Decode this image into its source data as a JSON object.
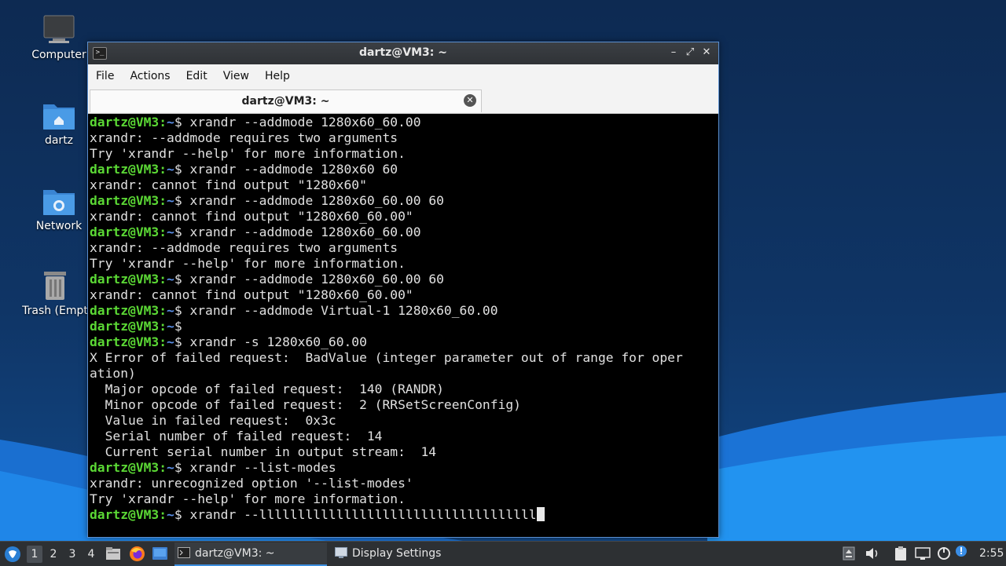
{
  "desktop": {
    "icons": [
      {
        "label": "Computer",
        "icon": "computer-icon"
      },
      {
        "label": "dartz",
        "icon": "home-folder-icon"
      },
      {
        "label": "Network",
        "icon": "network-folder-icon"
      },
      {
        "label": "Trash (Empt",
        "icon": "trash-icon"
      }
    ]
  },
  "window": {
    "title": "dartz@VM3: ~",
    "menu": [
      "File",
      "Actions",
      "Edit",
      "View",
      "Help"
    ],
    "tab_label": "dartz@VM3: ~",
    "buttons": {
      "minimize": "–",
      "maximize": "⤢",
      "close": "✕"
    }
  },
  "terminal": {
    "user_host": "dartz@VM3",
    "path": "~",
    "lines": [
      {
        "type": "prompt",
        "cmd": "xrandr --addmode 1280x60_60.00"
      },
      {
        "type": "out",
        "text": "xrandr: --addmode requires two arguments"
      },
      {
        "type": "out",
        "text": "Try 'xrandr --help' for more information."
      },
      {
        "type": "prompt",
        "cmd": "xrandr --addmode 1280x60 60"
      },
      {
        "type": "out",
        "text": "xrandr: cannot find output \"1280x60\""
      },
      {
        "type": "prompt",
        "cmd": "xrandr --addmode 1280x60_60.00 60"
      },
      {
        "type": "out",
        "text": "xrandr: cannot find output \"1280x60_60.00\""
      },
      {
        "type": "prompt",
        "cmd": "xrandr --addmode 1280x60_60.00"
      },
      {
        "type": "out",
        "text": "xrandr: --addmode requires two arguments"
      },
      {
        "type": "out",
        "text": "Try 'xrandr --help' for more information."
      },
      {
        "type": "prompt",
        "cmd": "xrandr --addmode 1280x60_60.00 60"
      },
      {
        "type": "out",
        "text": "xrandr: cannot find output \"1280x60_60.00\""
      },
      {
        "type": "prompt",
        "cmd": "xrandr --addmode Virtual-1 1280x60_60.00"
      },
      {
        "type": "prompt",
        "cmd": ""
      },
      {
        "type": "prompt",
        "cmd": "xrandr -s 1280x60_60.00"
      },
      {
        "type": "out",
        "text": "X Error of failed request:  BadValue (integer parameter out of range for oper"
      },
      {
        "type": "out",
        "text": "ation)"
      },
      {
        "type": "out",
        "text": "  Major opcode of failed request:  140 (RANDR)"
      },
      {
        "type": "out",
        "text": "  Minor opcode of failed request:  2 (RRSetScreenConfig)"
      },
      {
        "type": "out",
        "text": "  Value in failed request:  0x3c"
      },
      {
        "type": "out",
        "text": "  Serial number of failed request:  14"
      },
      {
        "type": "out",
        "text": "  Current serial number in output stream:  14"
      },
      {
        "type": "prompt",
        "cmd": "xrandr --list-modes"
      },
      {
        "type": "out",
        "text": "xrandr: unrecognized option '--list-modes'"
      },
      {
        "type": "out",
        "text": "Try 'xrandr --help' for more information."
      },
      {
        "type": "prompt",
        "cmd": "xrandr --llllllllllllllllllllllllllllllllllll",
        "cursor": true
      }
    ]
  },
  "taskbar": {
    "workspaces": [
      "1",
      "2",
      "3",
      "4"
    ],
    "active_workspace": "1",
    "tasks": [
      {
        "label": "dartz@VM3: ~",
        "icon": "terminal-icon",
        "active": true
      },
      {
        "label": "Display Settings",
        "icon": "display-icon",
        "active": false
      }
    ],
    "launchers": [
      "file-manager-icon",
      "firefox-icon",
      "desktop-icon"
    ],
    "tray": [
      "update-icon",
      "volume-icon",
      "clipboard-icon",
      "network-icon",
      "power-icon",
      "notification-icon"
    ],
    "clock": "2:55"
  },
  "colors": {
    "prompt_user": "#5bd835",
    "prompt_path": "#5a8fe8",
    "terminal_bg": "#000000",
    "taskbar_bg": "#2d3033"
  }
}
